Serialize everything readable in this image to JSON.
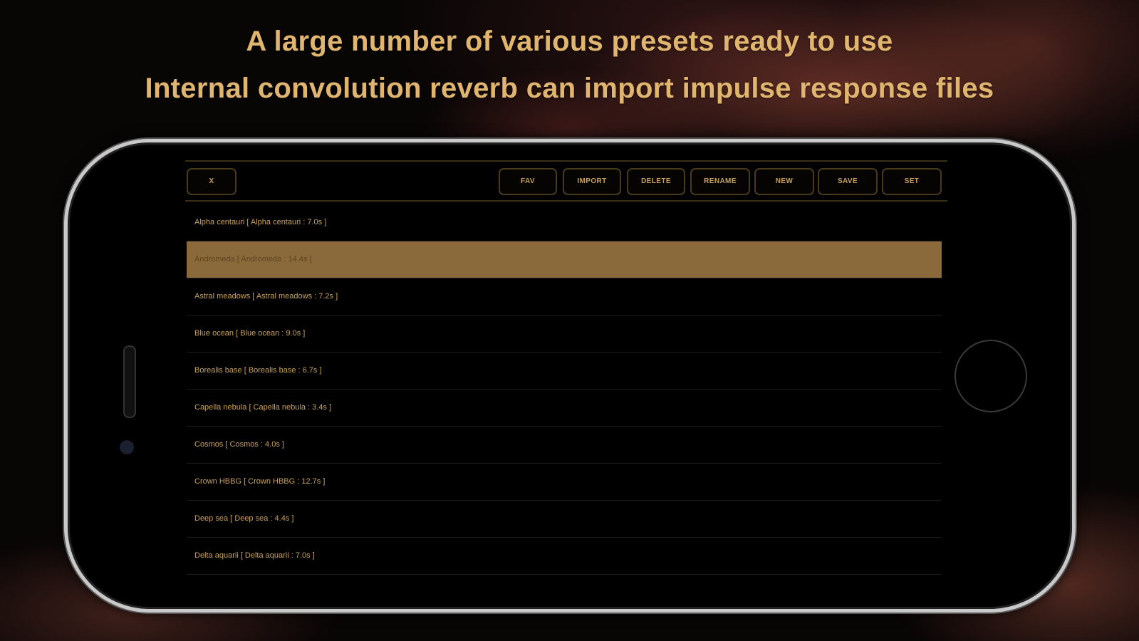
{
  "headline": {
    "line1": "A large number of various presets ready to use",
    "line2": "Internal convolution reverb can import impulse response files"
  },
  "toolbar": {
    "close_label": "X",
    "buttons": [
      {
        "label": "FAV"
      },
      {
        "label": "IMPORT"
      },
      {
        "label": "DELETE"
      },
      {
        "label": "RENAME"
      },
      {
        "label": "NEW"
      },
      {
        "label": "SAVE"
      },
      {
        "label": "SET"
      }
    ]
  },
  "presets": {
    "selected_index": 1,
    "items": [
      {
        "label": "Alpha centauri [ Alpha centauri : 7.0s ]"
      },
      {
        "label": "Andromeda [ Andromeda : 14.4s ]"
      },
      {
        "label": "Astral meadows [ Astral meadows : 7.2s ]"
      },
      {
        "label": "Blue ocean [ Blue ocean : 9.0s ]"
      },
      {
        "label": "Borealis base [ Borealis base : 6.7s ]"
      },
      {
        "label": "Capella nebula [ Capella nebula : 3.4s ]"
      },
      {
        "label": "Cosmos [ Cosmos : 4.0s ]"
      },
      {
        "label": "Crown HBBG [ Crown HBBG : 12.7s ]"
      },
      {
        "label": "Deep sea [ Deep sea : 4.4s ]"
      },
      {
        "label": "Delta aquarii [ Delta aquarii : 7.0s ]"
      }
    ]
  },
  "colors": {
    "accent": "#e0b56f",
    "selected_row": "#8a6a3a",
    "text_gold": "#c9a15c"
  }
}
